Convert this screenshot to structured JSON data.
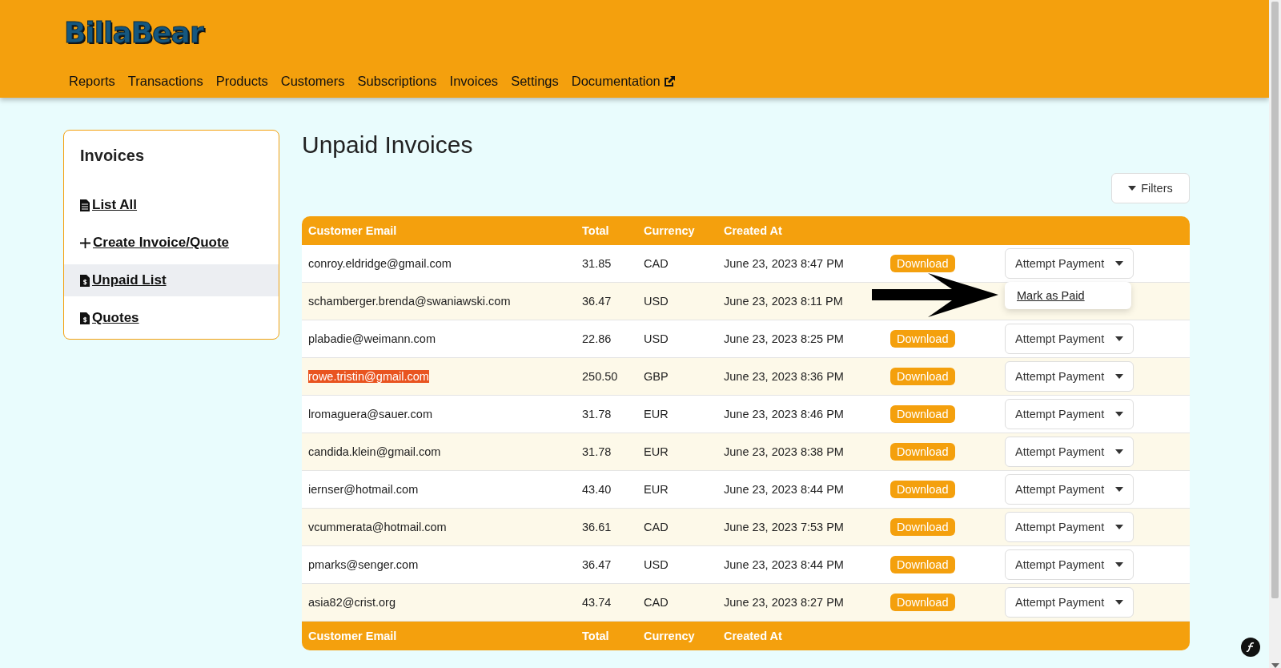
{
  "logo": "BillaBear",
  "nav": [
    {
      "label": "Reports",
      "external": false
    },
    {
      "label": "Transactions",
      "external": false
    },
    {
      "label": "Products",
      "external": false
    },
    {
      "label": "Customers",
      "external": false
    },
    {
      "label": "Subscriptions",
      "external": false
    },
    {
      "label": "Invoices",
      "external": false
    },
    {
      "label": "Settings",
      "external": false
    },
    {
      "label": "Documentation",
      "external": true
    }
  ],
  "sidebar": {
    "title": "Invoices",
    "items": [
      {
        "label": "List All",
        "kind": "file",
        "selected": false
      },
      {
        "label": "Create Invoice/Quote",
        "kind": "plus",
        "selected": false
      },
      {
        "label": "Unpaid List",
        "kind": "dollar",
        "selected": true
      },
      {
        "label": "Quotes",
        "kind": "dollar",
        "selected": false
      }
    ]
  },
  "page_title": "Unpaid Invoices",
  "filters_button": "Filters",
  "table": {
    "columns": [
      "Customer Email",
      "Total",
      "Currency",
      "Created At"
    ],
    "rows": [
      {
        "email": "conroy.eldridge@gmail.com",
        "total": "31.85",
        "currency": "CAD",
        "created": "June 23, 2023 8:47 PM",
        "download": "Download",
        "action": "Attempt Payment",
        "highlighted": false,
        "menu_open": true,
        "menu_item": "Mark as Paid"
      },
      {
        "email": "schamberger.brenda@swaniawski.com",
        "total": "36.47",
        "currency": "USD",
        "created": "June 23, 2023 8:11 PM",
        "highlighted": false,
        "menu_open": false
      },
      {
        "email": "plabadie@weimann.com",
        "total": "22.86",
        "currency": "USD",
        "created": "June 23, 2023 8:25 PM",
        "download": "Download",
        "action": "Attempt Payment",
        "highlighted": false,
        "menu_open": false
      },
      {
        "email": "rowe.tristin@gmail.com",
        "total": "250.50",
        "currency": "GBP",
        "created": "June 23, 2023 8:36 PM",
        "download": "Download",
        "action": "Attempt Payment",
        "highlighted": true,
        "menu_open": false
      },
      {
        "email": "lromaguera@sauer.com",
        "total": "31.78",
        "currency": "EUR",
        "created": "June 23, 2023 8:46 PM",
        "download": "Download",
        "action": "Attempt Payment",
        "highlighted": false,
        "menu_open": false
      },
      {
        "email": "candida.klein@gmail.com",
        "total": "31.78",
        "currency": "EUR",
        "created": "June 23, 2023 8:38 PM",
        "download": "Download",
        "action": "Attempt Payment",
        "highlighted": false,
        "menu_open": false
      },
      {
        "email": "iernser@hotmail.com",
        "total": "43.40",
        "currency": "EUR",
        "created": "June 23, 2023 8:44 PM",
        "download": "Download",
        "action": "Attempt Payment",
        "highlighted": false,
        "menu_open": false
      },
      {
        "email": "vcummerata@hotmail.com",
        "total": "36.61",
        "currency": "CAD",
        "created": "June 23, 2023 7:53 PM",
        "download": "Download",
        "action": "Attempt Payment",
        "highlighted": false,
        "menu_open": false
      },
      {
        "email": "pmarks@senger.com",
        "total": "36.47",
        "currency": "USD",
        "created": "June 23, 2023 8:44 PM",
        "download": "Download",
        "action": "Attempt Payment",
        "highlighted": false,
        "menu_open": false
      },
      {
        "email": "asia82@crist.org",
        "total": "43.74",
        "currency": "CAD",
        "created": "June 23, 2023 8:27 PM",
        "download": "Download",
        "action": "Attempt Payment",
        "highlighted": false,
        "menu_open": false
      }
    ],
    "footer": [
      "Customer Email",
      "Total",
      "Currency",
      "Created At"
    ]
  }
}
